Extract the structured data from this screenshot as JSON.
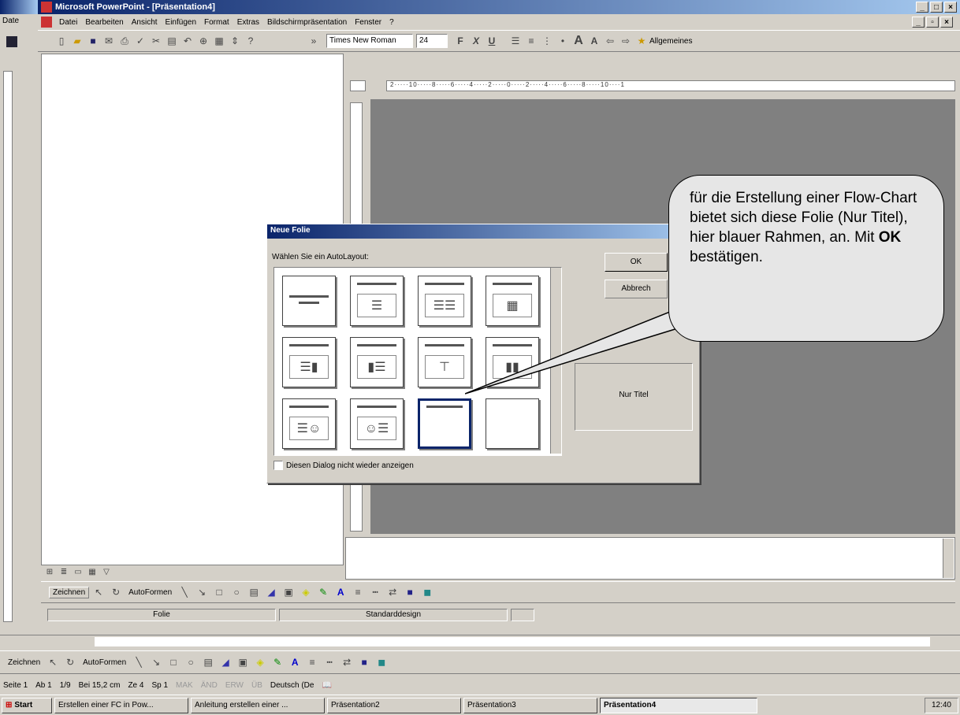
{
  "window": {
    "title": "Microsoft PowerPoint - [Präsentation4]",
    "menu_stub": "Date"
  },
  "menu": [
    "Datei",
    "Bearbeiten",
    "Ansicht",
    "Einfügen",
    "Format",
    "Extras",
    "Bildschirmpräsentation",
    "Fenster",
    "?"
  ],
  "toolbar": {
    "font": "Times New Roman",
    "size": "24",
    "bold": "F",
    "italic": "X",
    "underline": "U",
    "common_tasks": "Allgemeines"
  },
  "ruler_text": "2·····10·····8·····6·····4·····2·····0·····2·····4·····6·····8·····10····1",
  "dialog": {
    "title": "Neue Folie",
    "prompt": "Wählen Sie ein AutoLayout:",
    "ok": "OK",
    "cancel": "Abbrech",
    "preview_label": "Nur Titel",
    "checkbox_label": "Diesen Dialog nicht wieder anzeigen"
  },
  "callout": {
    "text_before": "für die Erstellung einer Flow-Chart bietet sich diese Folie (Nur Titel), hier blauer Rahmen, an. Mit ",
    "bold": "OK",
    "text_after": " bestätigen."
  },
  "inner_draw": {
    "draw": "Zeichnen",
    "autoshapes": "AutoFormen"
  },
  "inner_status": {
    "slide": "Folie",
    "design": "Standarddesign"
  },
  "outer_draw": {
    "draw": "Zeichnen",
    "autoshapes": "AutoFormen"
  },
  "word_status": {
    "page": "Seite 1",
    "section": "Ab 1",
    "pages": "1/9",
    "pos": "Bei 15,2 cm",
    "line": "Ze 4",
    "col": "Sp 1",
    "mak": "MAK",
    "änd": "ÄND",
    "erw": "ERW",
    "üb": "ÜB",
    "lang": "Deutsch (De"
  },
  "taskbar": {
    "start": "Start",
    "items": [
      "Erstellen einer FC in Pow...",
      "Anleitung erstellen einer ...",
      "Präsentation2",
      "Präsentation3",
      "Präsentation4"
    ],
    "clock": "12:40"
  },
  "colors": {
    "title_start": "#0a246a",
    "title_end": "#a6caf0",
    "workspace": "#808080",
    "callout_fill": "#e6e6e6",
    "selection": "#0a246a"
  }
}
